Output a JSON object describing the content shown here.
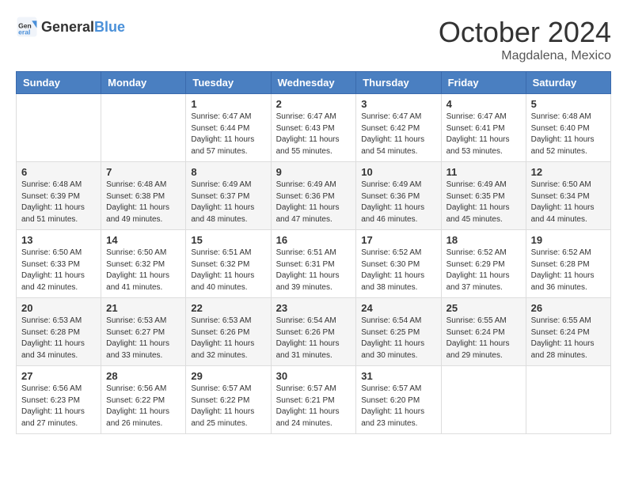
{
  "header": {
    "logo_general": "General",
    "logo_blue": "Blue",
    "month": "October 2024",
    "location": "Magdalena, Mexico"
  },
  "days_of_week": [
    "Sunday",
    "Monday",
    "Tuesday",
    "Wednesday",
    "Thursday",
    "Friday",
    "Saturday"
  ],
  "weeks": [
    [
      {
        "day": "",
        "info": ""
      },
      {
        "day": "",
        "info": ""
      },
      {
        "day": "1",
        "info": "Sunrise: 6:47 AM\nSunset: 6:44 PM\nDaylight: 11 hours and 57 minutes."
      },
      {
        "day": "2",
        "info": "Sunrise: 6:47 AM\nSunset: 6:43 PM\nDaylight: 11 hours and 55 minutes."
      },
      {
        "day": "3",
        "info": "Sunrise: 6:47 AM\nSunset: 6:42 PM\nDaylight: 11 hours and 54 minutes."
      },
      {
        "day": "4",
        "info": "Sunrise: 6:47 AM\nSunset: 6:41 PM\nDaylight: 11 hours and 53 minutes."
      },
      {
        "day": "5",
        "info": "Sunrise: 6:48 AM\nSunset: 6:40 PM\nDaylight: 11 hours and 52 minutes."
      }
    ],
    [
      {
        "day": "6",
        "info": "Sunrise: 6:48 AM\nSunset: 6:39 PM\nDaylight: 11 hours and 51 minutes."
      },
      {
        "day": "7",
        "info": "Sunrise: 6:48 AM\nSunset: 6:38 PM\nDaylight: 11 hours and 49 minutes."
      },
      {
        "day": "8",
        "info": "Sunrise: 6:49 AM\nSunset: 6:37 PM\nDaylight: 11 hours and 48 minutes."
      },
      {
        "day": "9",
        "info": "Sunrise: 6:49 AM\nSunset: 6:36 PM\nDaylight: 11 hours and 47 minutes."
      },
      {
        "day": "10",
        "info": "Sunrise: 6:49 AM\nSunset: 6:36 PM\nDaylight: 11 hours and 46 minutes."
      },
      {
        "day": "11",
        "info": "Sunrise: 6:49 AM\nSunset: 6:35 PM\nDaylight: 11 hours and 45 minutes."
      },
      {
        "day": "12",
        "info": "Sunrise: 6:50 AM\nSunset: 6:34 PM\nDaylight: 11 hours and 44 minutes."
      }
    ],
    [
      {
        "day": "13",
        "info": "Sunrise: 6:50 AM\nSunset: 6:33 PM\nDaylight: 11 hours and 42 minutes."
      },
      {
        "day": "14",
        "info": "Sunrise: 6:50 AM\nSunset: 6:32 PM\nDaylight: 11 hours and 41 minutes."
      },
      {
        "day": "15",
        "info": "Sunrise: 6:51 AM\nSunset: 6:32 PM\nDaylight: 11 hours and 40 minutes."
      },
      {
        "day": "16",
        "info": "Sunrise: 6:51 AM\nSunset: 6:31 PM\nDaylight: 11 hours and 39 minutes."
      },
      {
        "day": "17",
        "info": "Sunrise: 6:52 AM\nSunset: 6:30 PM\nDaylight: 11 hours and 38 minutes."
      },
      {
        "day": "18",
        "info": "Sunrise: 6:52 AM\nSunset: 6:29 PM\nDaylight: 11 hours and 37 minutes."
      },
      {
        "day": "19",
        "info": "Sunrise: 6:52 AM\nSunset: 6:28 PM\nDaylight: 11 hours and 36 minutes."
      }
    ],
    [
      {
        "day": "20",
        "info": "Sunrise: 6:53 AM\nSunset: 6:28 PM\nDaylight: 11 hours and 34 minutes."
      },
      {
        "day": "21",
        "info": "Sunrise: 6:53 AM\nSunset: 6:27 PM\nDaylight: 11 hours and 33 minutes."
      },
      {
        "day": "22",
        "info": "Sunrise: 6:53 AM\nSunset: 6:26 PM\nDaylight: 11 hours and 32 minutes."
      },
      {
        "day": "23",
        "info": "Sunrise: 6:54 AM\nSunset: 6:26 PM\nDaylight: 11 hours and 31 minutes."
      },
      {
        "day": "24",
        "info": "Sunrise: 6:54 AM\nSunset: 6:25 PM\nDaylight: 11 hours and 30 minutes."
      },
      {
        "day": "25",
        "info": "Sunrise: 6:55 AM\nSunset: 6:24 PM\nDaylight: 11 hours and 29 minutes."
      },
      {
        "day": "26",
        "info": "Sunrise: 6:55 AM\nSunset: 6:24 PM\nDaylight: 11 hours and 28 minutes."
      }
    ],
    [
      {
        "day": "27",
        "info": "Sunrise: 6:56 AM\nSunset: 6:23 PM\nDaylight: 11 hours and 27 minutes."
      },
      {
        "day": "28",
        "info": "Sunrise: 6:56 AM\nSunset: 6:22 PM\nDaylight: 11 hours and 26 minutes."
      },
      {
        "day": "29",
        "info": "Sunrise: 6:57 AM\nSunset: 6:22 PM\nDaylight: 11 hours and 25 minutes."
      },
      {
        "day": "30",
        "info": "Sunrise: 6:57 AM\nSunset: 6:21 PM\nDaylight: 11 hours and 24 minutes."
      },
      {
        "day": "31",
        "info": "Sunrise: 6:57 AM\nSunset: 6:20 PM\nDaylight: 11 hours and 23 minutes."
      },
      {
        "day": "",
        "info": ""
      },
      {
        "day": "",
        "info": ""
      }
    ]
  ]
}
